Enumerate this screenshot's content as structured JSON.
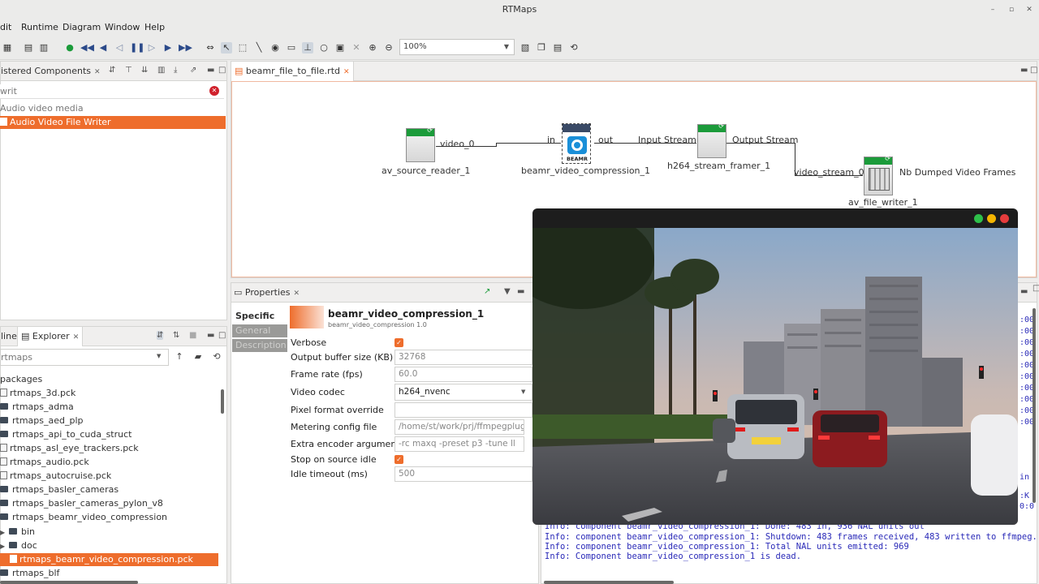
{
  "window": {
    "title": "RTMaps"
  },
  "menu": [
    "dit",
    "Runtime",
    "Diagram",
    "Window",
    "Help"
  ],
  "toolbar": {
    "zoom": "100%"
  },
  "registered": {
    "tab_label": "istered Components",
    "search_value": "writ",
    "category": "Audio video media",
    "selected_item": "Audio Video File Writer"
  },
  "diagram": {
    "tab_label": "beamr_file_to_file.rtd",
    "components": [
      {
        "name": "av_source_reader_1"
      },
      {
        "name": "beamr_video_compression_1",
        "badge": "BEAMR"
      },
      {
        "name": "h264_stream_framer_1"
      },
      {
        "name": "av_file_writer_1"
      }
    ],
    "ports": {
      "video_0": "video_0",
      "in": "in",
      "out": "out",
      "input_stream": "Input Stream",
      "output_stream": "Output Stream",
      "video_stream_0": "video_stream_0",
      "nb_dumped": "Nb Dumped Video Frames"
    }
  },
  "properties": {
    "tab_label": "Properties",
    "tabs": [
      "Specific",
      "General",
      "Description"
    ],
    "component_title": "beamr_video_compression_1",
    "component_subtitle": "beamr_video_compression 1.0",
    "rows": [
      {
        "label": "Verbose",
        "type": "checkbox",
        "checked": true
      },
      {
        "label": "Output buffer size (KB)",
        "value": "32768"
      },
      {
        "label": "Frame rate (fps)",
        "value": "60.0"
      },
      {
        "label": "Video codec",
        "value": "h264_nvenc"
      },
      {
        "label": "Pixel format override",
        "value": ""
      },
      {
        "label": "Metering config file",
        "value": "/home/st/work/prj/ffmpegplugin"
      },
      {
        "label": "Extra encoder arguments",
        "value": "-rc maxq -preset p3 -tune ll"
      },
      {
        "label": "Stop on source idle",
        "type": "checkbox",
        "checked": true
      },
      {
        "label": "Idle timeout (ms)",
        "value": "500"
      }
    ]
  },
  "explorer": {
    "tab_outline": "line",
    "tab_label": "Explorer",
    "path_value": "rtmaps",
    "root": "packages",
    "items": [
      {
        "label": "rtmaps_3d.pck",
        "kind": "file"
      },
      {
        "label": "rtmaps_adma",
        "kind": "folder"
      },
      {
        "label": "rtmaps_aed_plp",
        "kind": "folder"
      },
      {
        "label": "rtmaps_api_to_cuda_struct",
        "kind": "folder"
      },
      {
        "label": "rtmaps_asl_eye_trackers.pck",
        "kind": "file"
      },
      {
        "label": "rtmaps_audio.pck",
        "kind": "file"
      },
      {
        "label": "rtmaps_autocruise.pck",
        "kind": "file"
      },
      {
        "label": "rtmaps_basler_cameras",
        "kind": "folder"
      },
      {
        "label": "rtmaps_basler_cameras_pylon_v8",
        "kind": "folder"
      },
      {
        "label": "rtmaps_beamr_video_compression",
        "kind": "folder-open"
      },
      {
        "label": "bin",
        "kind": "subfolder"
      },
      {
        "label": "doc",
        "kind": "subfolder"
      },
      {
        "label": "rtmaps_beamr_video_compression.pck",
        "kind": "selected"
      },
      {
        "label": "rtmaps_blf",
        "kind": "folder"
      }
    ]
  },
  "console": {
    "lines": [
      "Info: component beamr_video_compression_1: Done: 483 in, 936 NAL units out",
      "Info: component beamr_video_compression_1: Shutdown: 483 frames received, 483 written to ffmpeg.",
      "Info: component beamr_video_compression_1: Total NAL units emitted: 969",
      "Info: Component beamr_video_compression_1 is dead."
    ],
    "right_edge": [
      ":00",
      ":00",
      ":00",
      ":00",
      ":00",
      ":00",
      ":00",
      ":00",
      ":00",
      ":00",
      "in",
      ":K",
      "0:0"
    ]
  },
  "colors": {
    "accent": "#ee6d2c",
    "component_header": "#1b9b3a",
    "console_text": "#2a2ab8"
  }
}
